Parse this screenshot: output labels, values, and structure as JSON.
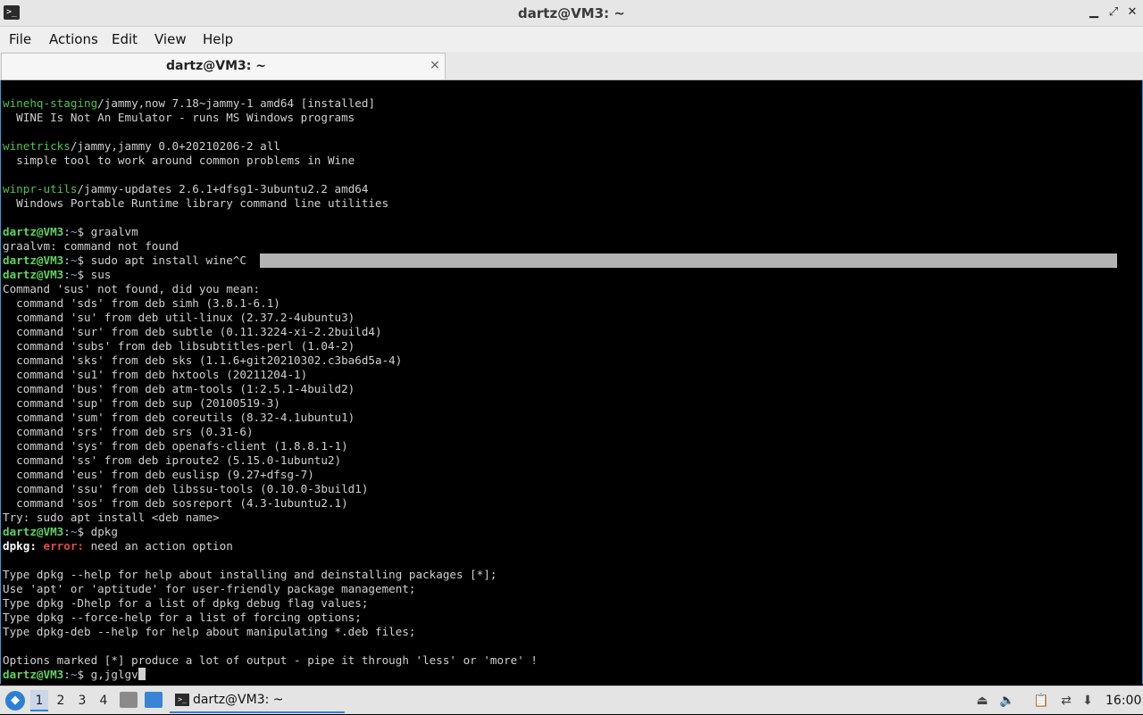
{
  "window": {
    "title": "dartz@VM3: ~",
    "icon": "terminal-icon",
    "buttons": {
      "minimize": "▁",
      "maximize": "⤢",
      "close": "✕"
    }
  },
  "menu": [
    "File",
    "Actions",
    "Edit",
    "View",
    "Help"
  ],
  "tab": {
    "label": "dartz@VM3: ~",
    "close": "×"
  },
  "terminal": {
    "colors": {
      "prompt": "#5fd35f",
      "path": "#7aa6da",
      "error": "#e04b4b",
      "package": "#4ec24e"
    },
    "lines": {
      "l0_pkg": "winehq-staging",
      "l0_rest": "/jammy,now 7.18~jammy-1 amd64 [installed]",
      "l1": "  WINE Is Not An Emulator - runs MS Windows programs",
      "l3_pkg": "winetricks",
      "l3_rest": "/jammy,jammy 0.0+20210206-2 all",
      "l4": "  simple tool to work around common problems in Wine",
      "l6_pkg": "winpr-utils",
      "l6_rest": "/jammy-updates 2.6.1+dfsg1-3ubuntu2.2 amd64",
      "l7": "  Windows Portable Runtime library command line utilities",
      "prompt_user": "dartz@VM3",
      "prompt_colon": ":",
      "prompt_path": "~",
      "prompt_dollar": "$ ",
      "c9": "graalvm",
      "l10": "graalvm: command not found",
      "c11": "sudo apt install wine^C",
      "c12": "sus",
      "l13": "Command 'sus' not found, did you mean:",
      "l14": "  command 'sds' from deb simh (3.8.1-6.1)",
      "l15": "  command 'su' from deb util-linux (2.37.2-4ubuntu3)",
      "l16": "  command 'sur' from deb subtle (0.11.3224-xi-2.2build4)",
      "l17": "  command 'subs' from deb libsubtitles-perl (1.04-2)",
      "l18": "  command 'sks' from deb sks (1.1.6+git20210302.c3ba6d5a-4)",
      "l19": "  command 'su1' from deb hxtools (20211204-1)",
      "l20": "  command 'bus' from deb atm-tools (1:2.5.1-4build2)",
      "l21": "  command 'sup' from deb sup (20100519-3)",
      "l22": "  command 'sum' from deb coreutils (8.32-4.1ubuntu1)",
      "l23": "  command 'srs' from deb srs (0.31-6)",
      "l24": "  command 'sys' from deb openafs-client (1.8.8.1-1)",
      "l25": "  command 'ss' from deb iproute2 (5.15.0-1ubuntu2)",
      "l26": "  command 'eus' from deb euslisp (9.27+dfsg-7)",
      "l27": "  command 'ssu' from deb libssu-tools (0.10.0-3build1)",
      "l28": "  command 'sos' from deb sosreport (4.3-1ubuntu2.1)",
      "l29": "Try: sudo apt install <deb name>",
      "c30": "dpkg",
      "l31_a": "dpkg: ",
      "l31_b": "error:",
      "l31_c": " need an action option",
      "l33": "Type dpkg --help for help about installing and deinstalling packages [*];",
      "l34": "Use 'apt' or 'aptitude' for user-friendly package management;",
      "l35": "Type dpkg -Dhelp for a list of dpkg debug flag values;",
      "l36": "Type dpkg --force-help for a list of forcing options;",
      "l37": "Type dpkg-deb --help for help about manipulating *.deb files;",
      "l39": "Options marked [*] produce a lot of output - pipe it through 'less' or 'more' !",
      "c40": "g,jglgv"
    }
  },
  "taskbar": {
    "start_icon": "lxqt-start-icon",
    "workspaces": [
      "1",
      "2",
      "3",
      "4"
    ],
    "active_workspace": "1",
    "task_label": "dartz@VM3: ~",
    "tray_icons": [
      "eject-icon",
      "volume-icon",
      "clipboard-icon",
      "network-icon",
      "update-icon"
    ],
    "clock": "16:00"
  }
}
